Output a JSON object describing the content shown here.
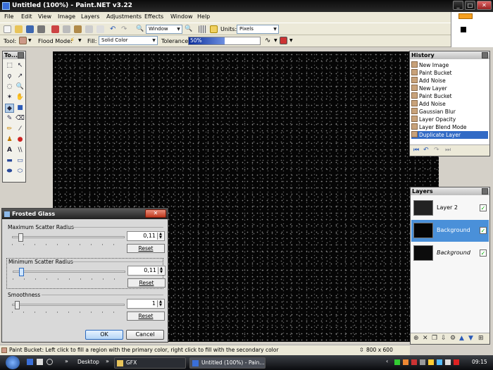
{
  "window": {
    "title": "Untitled (100%) - Paint.NET v3.22",
    "min": "_",
    "max": "□",
    "close": "✕"
  },
  "menu": [
    "File",
    "Edit",
    "View",
    "Image",
    "Layers",
    "Adjustments",
    "Effects",
    "Window",
    "Help"
  ],
  "toolbar": {
    "zoom_value": "Window",
    "units_label": "Units:",
    "units_value": "Pixels"
  },
  "toolbar2": {
    "tool_label": "Tool:",
    "flood_label": "Flood Mode:",
    "fill_label": "Fill:",
    "fill_value": "Solid Color",
    "tolerance_label": "Tolerance:",
    "tolerance_value": "50%",
    "tolerance": 0.5
  },
  "tools_panel": {
    "title": "To..."
  },
  "history": {
    "title": "History",
    "items": [
      "New Image",
      "Paint Bucket",
      "Add Noise",
      "New Layer",
      "Paint Bucket",
      "Add Noise",
      "Gaussian Blur",
      "Layer Opacity",
      "Layer Blend Mode",
      "Duplicate Layer"
    ]
  },
  "layers": {
    "title": "Layers",
    "items": [
      {
        "name": "Layer 2",
        "visible": true
      },
      {
        "name": "Background",
        "visible": true
      },
      {
        "name": "Background",
        "visible": true
      }
    ]
  },
  "dialog": {
    "title": "Frosted Glass",
    "close": "✕",
    "groups": [
      {
        "label": "Maximum Scatter Radius",
        "value": "0,11",
        "reset": "Reset",
        "level": 0.05
      },
      {
        "label": "Minimum Scatter Radius",
        "value": "0,11",
        "reset": "Reset",
        "level": 0.05
      },
      {
        "label": "Smoothness",
        "value": "1",
        "reset": "Reset",
        "level": 0.02
      }
    ],
    "ok": "OK",
    "cancel": "Cancel"
  },
  "status": {
    "text": "Paint Bucket: Left click to fill a region with the primary color, right click to fill with the secondary color",
    "size": "800 x 600"
  },
  "taskbar": {
    "desktop": "Desktop",
    "gfx": "GFX",
    "app": "Untitled (100%) - Pain...",
    "clock": "09:15"
  }
}
